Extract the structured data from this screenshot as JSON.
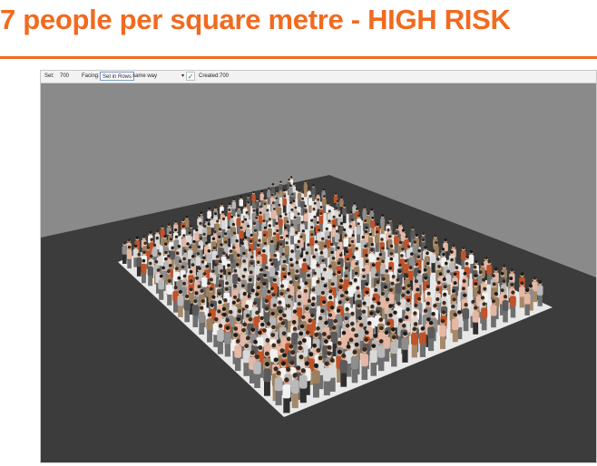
{
  "slide": {
    "title": "7 people per square metre - HIGH RISK",
    "title_color": "#f26a1f",
    "rule_color": "#f26a1f"
  },
  "toolbar": {
    "set_label": "Set:",
    "set_value": "700",
    "facing_label": "Facing:",
    "arrangement_value": "Set in Rows",
    "direction_value": "same way",
    "dropdown_arrow": "▾",
    "confirm_icon": "checkmark-icon",
    "created_label": "Created:",
    "created_value": "700"
  },
  "scene": {
    "background_wall_color": "#8a8a8a",
    "floor_color": "#3c3c3c",
    "platform_color": "#e8e8e8",
    "crowd_palette": [
      "#8e8e8e",
      "#b9b9b9",
      "#d9d9d9",
      "#c0532a",
      "#e5b7a5",
      "#f1f1f1",
      "#5a5a5a",
      "#9c8060"
    ]
  }
}
